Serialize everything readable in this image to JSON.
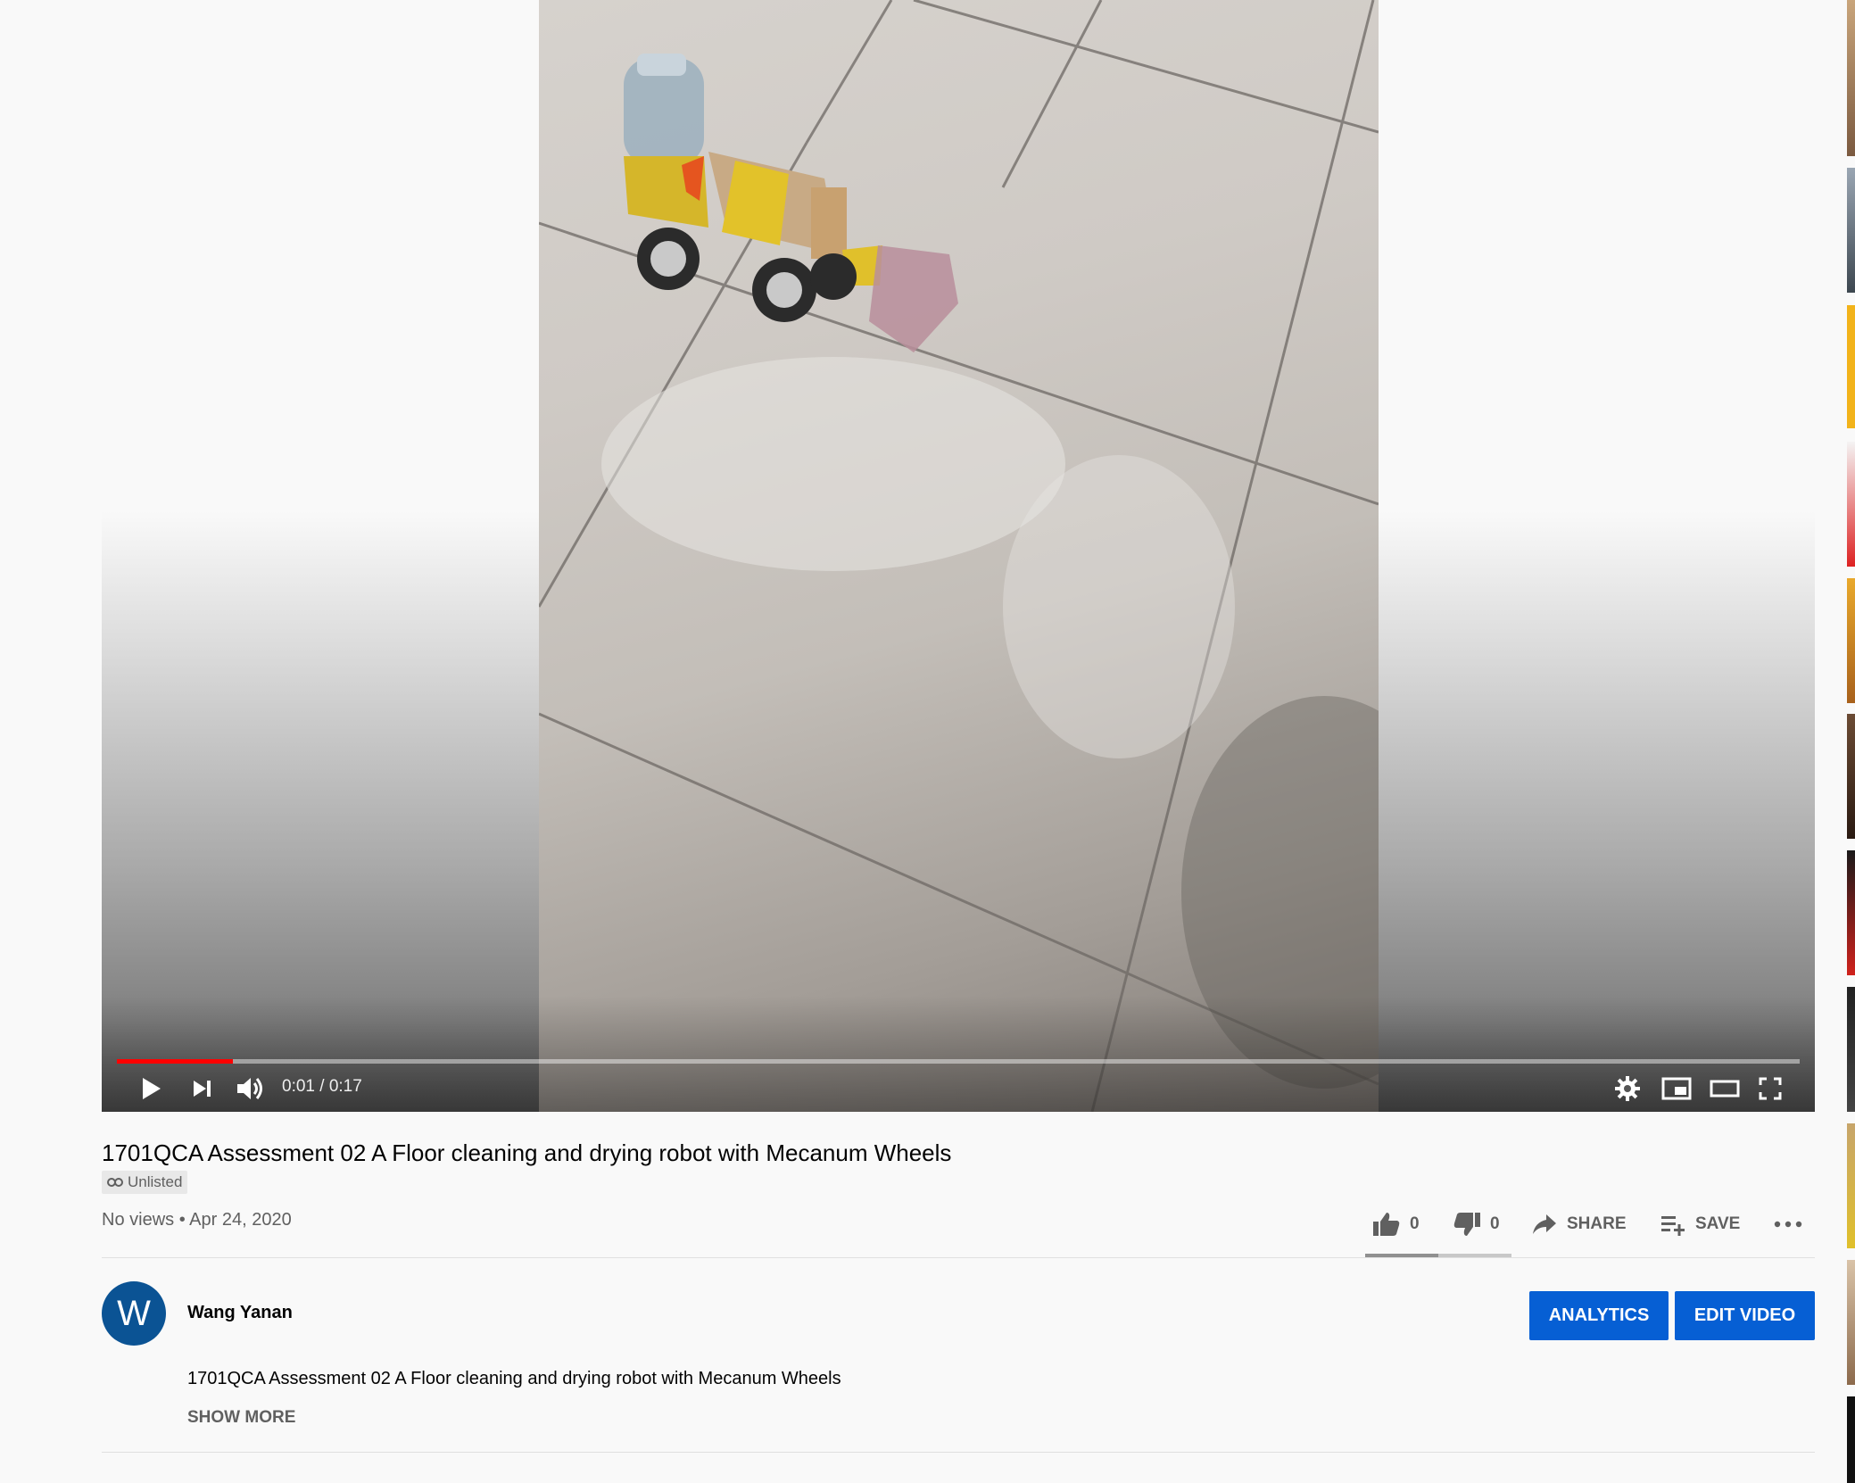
{
  "player": {
    "time_current": "0:01",
    "time_separator": "/",
    "time_total": "0:17",
    "progress_fraction": 0.069,
    "colors": {
      "progress": "#ff0000"
    }
  },
  "video": {
    "title": "1701QCA Assessment 02 A Floor cleaning and drying robot with Mecanum Wheels",
    "visibility_label": "Unlisted",
    "views": "No views",
    "meta_separator": "•",
    "date": "Apr 24, 2020"
  },
  "actions": {
    "like_count": "0",
    "dislike_count": "0",
    "share_label": "SHARE",
    "save_label": "SAVE"
  },
  "channel": {
    "avatar_letter": "W",
    "name": "Wang Yanan",
    "analytics_label": "ANALYTICS",
    "edit_video_label": "EDIT VIDEO",
    "description": "1701QCA Assessment 02 A Floor cleaning and drying robot with Mecanum Wheels",
    "show_more_label": "SHOW MORE",
    "colors": {
      "avatar": "#0b5394",
      "button": "#065fd4"
    }
  },
  "icons": {
    "play": "play-icon",
    "next": "next-icon",
    "volume": "volume-icon",
    "settings": "gear-icon",
    "miniplayer": "miniplayer-icon",
    "theater": "theater-icon",
    "fullscreen": "fullscreen-icon",
    "like": "thumbs-up-icon",
    "dislike": "thumbs-down-icon",
    "share": "share-icon",
    "save": "playlist-add-icon",
    "more": "more-icon",
    "unlisted": "link-icon"
  }
}
